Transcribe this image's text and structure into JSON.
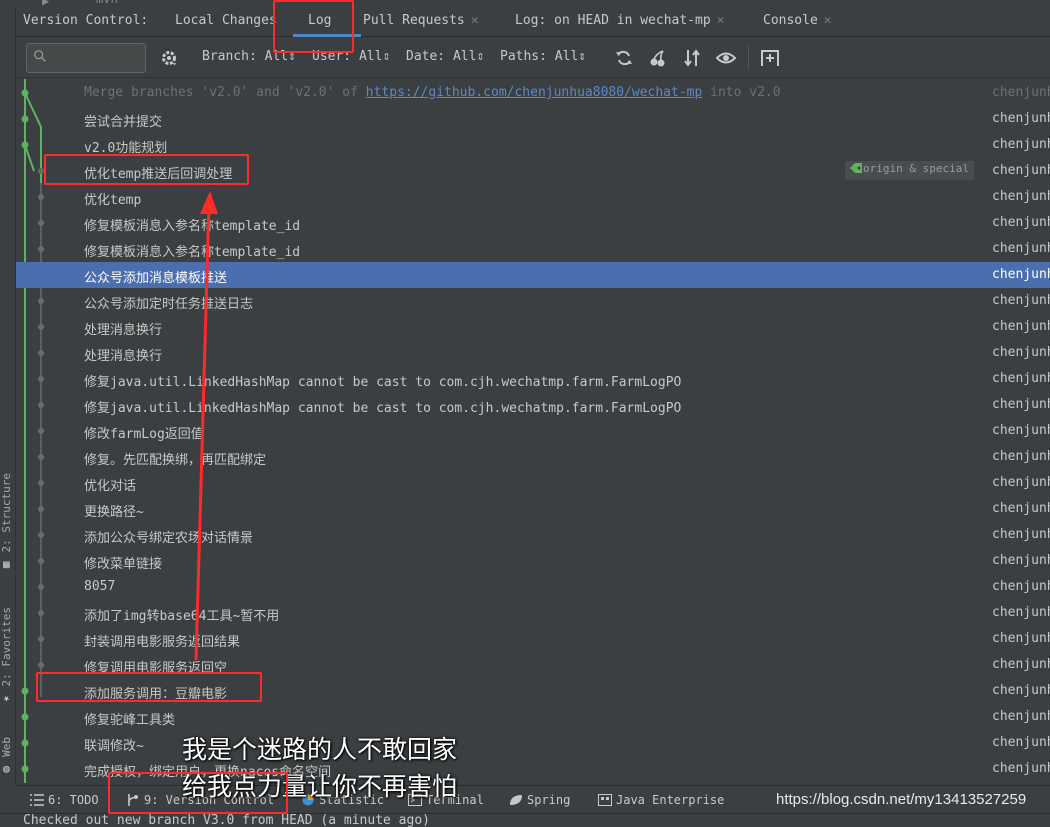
{
  "top_strip": {
    "item": "mvn"
  },
  "left_strip": {
    "structure": "2: Structure",
    "favorites": "2: Favorites",
    "web": "Web"
  },
  "tabbar": {
    "title": "Version Control:",
    "tabs": [
      {
        "label": "Local Changes",
        "closable": false
      },
      {
        "label": "Log",
        "closable": false,
        "active": true
      },
      {
        "label": "Pull Requests",
        "closable": true
      },
      {
        "label": "Log: on HEAD in wechat-mp",
        "closable": true
      },
      {
        "label": "Console",
        "closable": true
      }
    ]
  },
  "toolbar": {
    "search_value": "",
    "filters": {
      "branch": "Branch: All",
      "user": "User: All",
      "date": "Date: All",
      "paths": "Paths: All"
    },
    "icons": [
      "settings-icon",
      "refresh-icon",
      "cherry-pick-icon",
      "expand-icon",
      "eye-icon",
      "new-tab-icon"
    ]
  },
  "log": {
    "merge_row": {
      "prefix": "Merge branches 'v2.0' and 'v2.0' of ",
      "link": "https://github.com/chenjunhua8080/wechat-mp",
      "suffix": " into v2.0",
      "author": "chenjunh"
    },
    "tag": "origin & special",
    "rows": [
      {
        "msg": "尝试合并提交",
        "author": "chenjunh"
      },
      {
        "msg": "v2.0功能规划",
        "author": "chenjunh"
      },
      {
        "msg": "优化temp推送后回调处理",
        "author": "chenjunh",
        "tagged": true
      },
      {
        "msg": "优化temp",
        "author": "chenjunh"
      },
      {
        "msg": "修复模板消息入参名称template_id",
        "author": "chenjunh"
      },
      {
        "msg": "修复模板消息入参名称template_id",
        "author": "chenjunh"
      },
      {
        "msg": "公众号添加消息模板推送",
        "author": "chenjunh",
        "selected": true
      },
      {
        "msg": "公众号添加定时任务推送日志",
        "author": "chenjunh"
      },
      {
        "msg": "处理消息换行",
        "author": "chenjunh"
      },
      {
        "msg": "处理消息换行",
        "author": "chenjunh"
      },
      {
        "msg": "修复java.util.LinkedHashMap cannot be cast to com.cjh.wechatmp.farm.FarmLogPO",
        "author": "chenjunh"
      },
      {
        "msg": "修复java.util.LinkedHashMap cannot be cast to com.cjh.wechatmp.farm.FarmLogPO",
        "author": "chenjunh"
      },
      {
        "msg": "修改farmLog返回值",
        "author": "chenjunh"
      },
      {
        "msg": "修复。先匹配换绑，再匹配绑定",
        "author": "chenjunh"
      },
      {
        "msg": "优化对话",
        "author": "chenjunh"
      },
      {
        "msg": "更换路径~",
        "author": "chenjunh"
      },
      {
        "msg": "添加公众号绑定农场对话情景",
        "author": "chenjunh"
      },
      {
        "msg": "修改菜单链接",
        "author": "chenjunh"
      },
      {
        "msg": "8057",
        "author": "chenjunh"
      },
      {
        "msg": "添加了img转base64工具~暂不用",
        "author": "chenjunh"
      },
      {
        "msg": "封装调用电影服务返回结果",
        "author": "chenjunh"
      },
      {
        "msg": "修复调用电影服务返回空",
        "author": "chenjunh"
      },
      {
        "msg": "添加服务调用：豆瓣电影",
        "author": "chenjunh"
      },
      {
        "msg": "修复驼峰工具类",
        "author": "chenjunh"
      },
      {
        "msg": "联调修改~",
        "author": "chenjunh"
      },
      {
        "msg": "完成授权，绑定用户，更换nacos命名空间",
        "author": "chenjunh"
      }
    ]
  },
  "bottombar": {
    "tabs": [
      {
        "label": "6: TODO",
        "icon": "list-icon"
      },
      {
        "label": "9: Version Control",
        "icon": "branch-icon"
      },
      {
        "label": "Statistic",
        "icon": "pie-icon"
      },
      {
        "label": "Terminal",
        "icon": "terminal-icon"
      },
      {
        "label": "Spring",
        "icon": "spring-leaf-icon"
      },
      {
        "label": "Java Enterprise",
        "icon": "java-enterprise-icon"
      }
    ],
    "watermark": "https://blog.csdn.net/my13413527259"
  },
  "statusbar": {
    "text": "Checked out new branch V3.0 from HEAD (a minute ago)"
  },
  "subtitles": {
    "line1": "我是个迷路的人不敢回家",
    "line2": "给我点力量让你不再害怕"
  },
  "colors": {
    "background": "#3c3f41",
    "selection": "#4b6eaf",
    "graph_green": "#5fb35f",
    "annotation_red": "#ff2a2a",
    "link": "#5a89c7"
  }
}
